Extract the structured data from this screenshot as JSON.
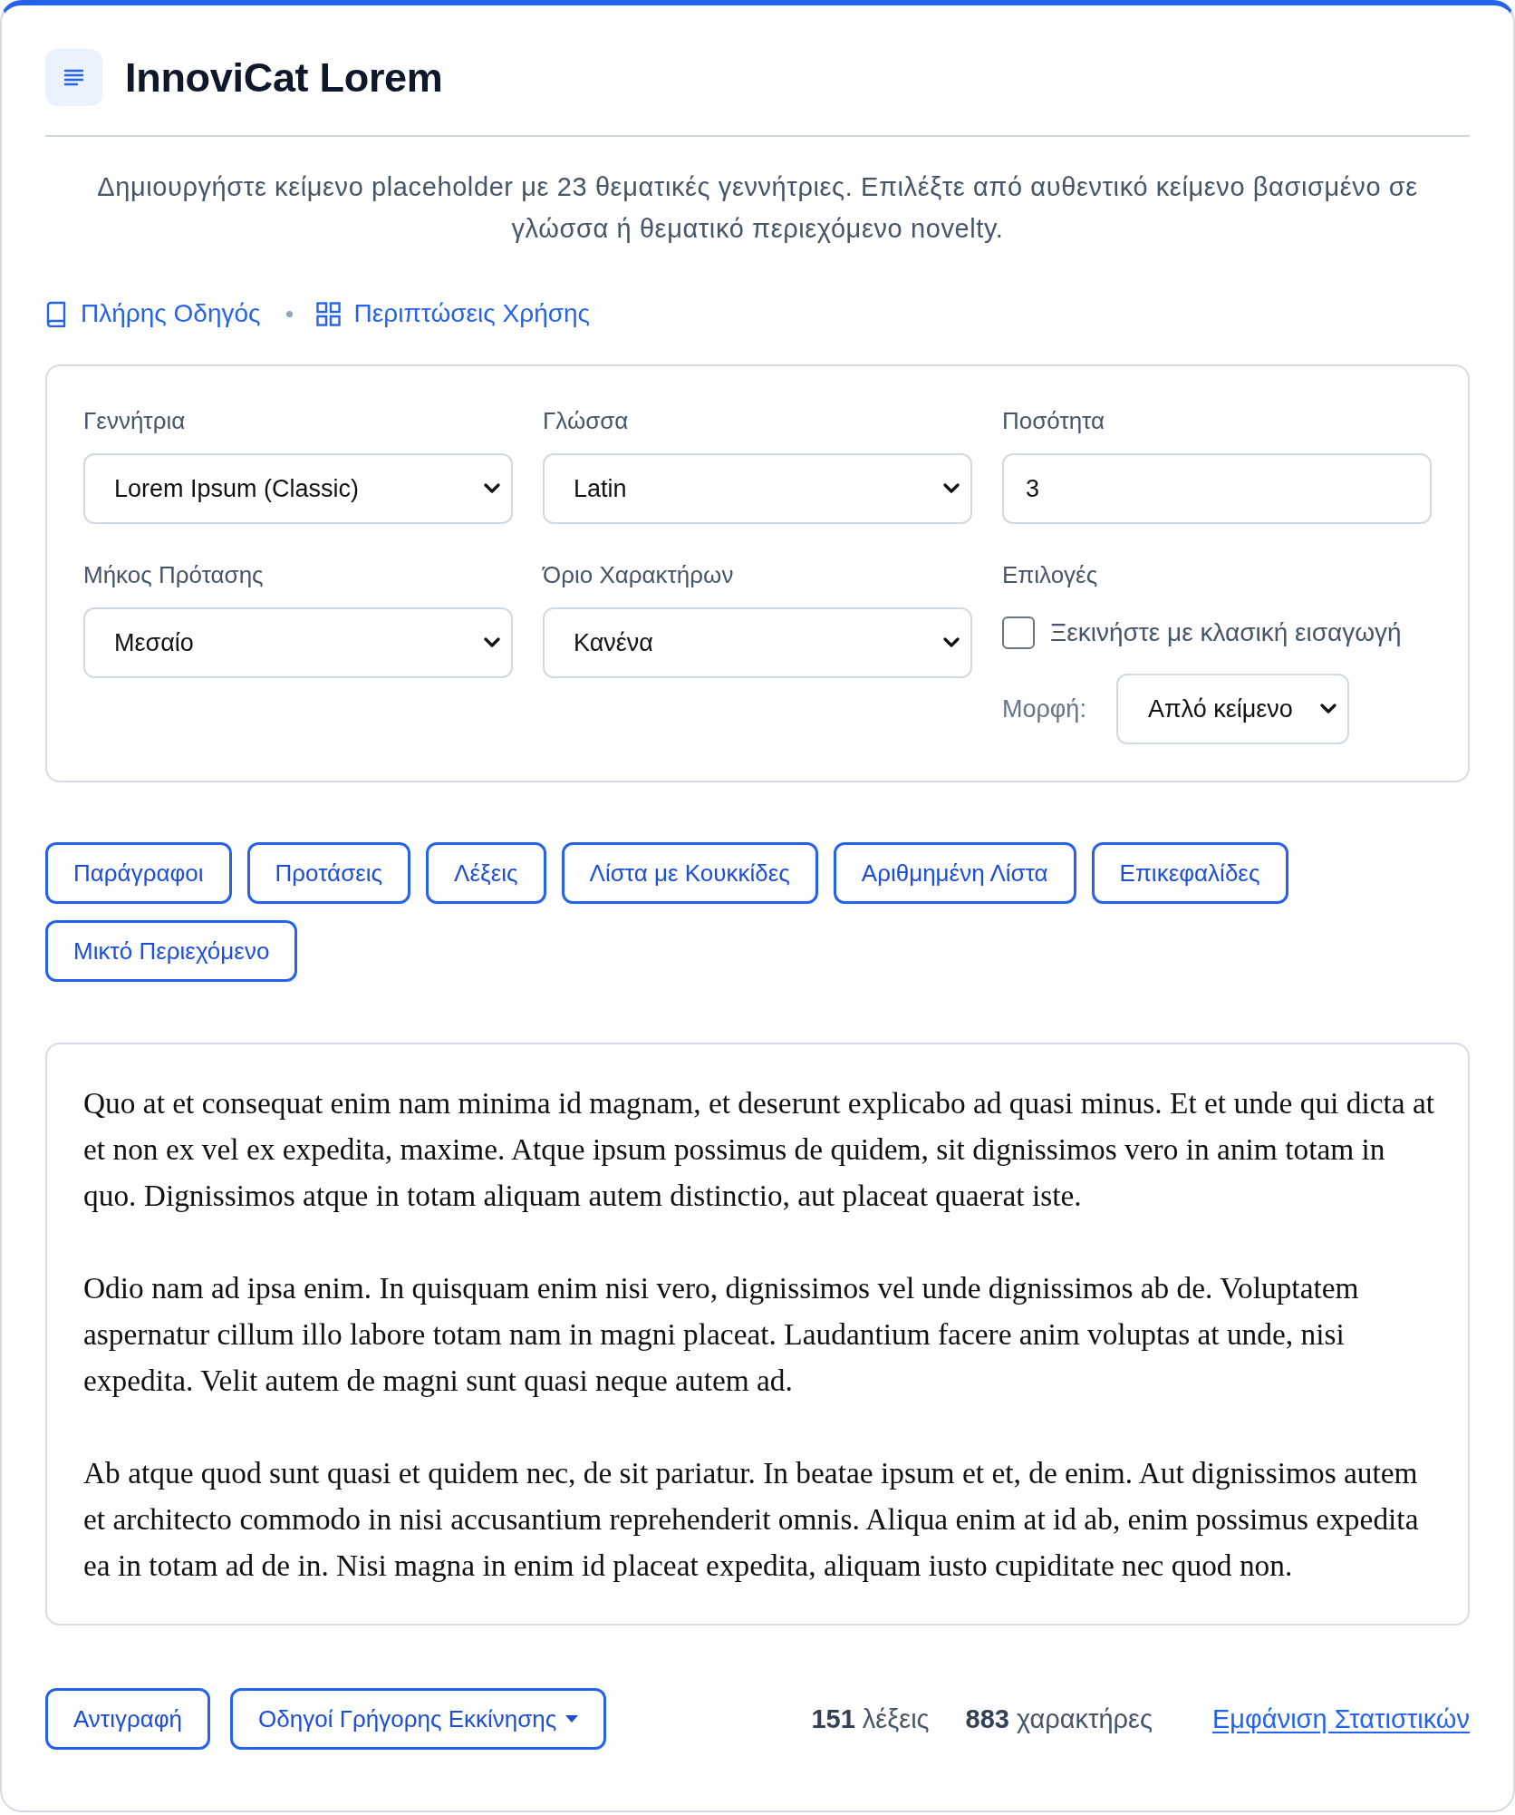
{
  "header": {
    "title": "InnoviCat Lorem"
  },
  "description": "Δημιουργήστε κείμενο placeholder με 23 θεματικές γεννήτριες. Επιλέξτε από αυθεντικό κείμενο βασισμένο σε γλώσσα ή θεματικό περιεχόμενο novelty.",
  "links": [
    "Πλήρης Οδηγός",
    "Περιπτώσεις Χρήσης"
  ],
  "settings": {
    "fields": [
      {
        "kind": "select",
        "label": "Γεννήτρια",
        "value": "Lorem Ipsum (Classic)"
      },
      {
        "kind": "select",
        "label": "Γλώσσα",
        "value": "Latin"
      },
      {
        "kind": "input",
        "label": "Ποσότητα",
        "value": "3"
      },
      {
        "kind": "select",
        "label": "Μήκος Πρότασης",
        "value": "Μεσαίο"
      },
      {
        "kind": "select",
        "label": "Όριο Χαρακτήρων",
        "value": "Κανένα"
      },
      {
        "kind": "options",
        "label": "Επιλογές",
        "checkbox": {
          "label": "Ξεκινήστε με κλασική εισαγωγή",
          "checked": false
        },
        "format": {
          "label": "Μορφή:",
          "value": "Απλό κείμενο"
        }
      }
    ]
  },
  "modes": [
    "Παράγραφοι",
    "Προτάσεις",
    "Λέξεις",
    "Λίστα με Κουκκίδες",
    "Αριθμημένη Λίστα",
    "Επικεφαλίδες",
    "Μικτό Περιεχόμενο"
  ],
  "output": {
    "paragraphs": [
      "Quo at et consequat enim nam minima id magnam, et deserunt explicabo ad quasi minus. Et et unde qui dicta at et non ex vel ex expedita, maxime. Atque ipsum possimus de quidem, sit dignissimos vero in anim totam in quo. Dignissimos atque in totam aliquam autem distinctio, aut placeat quaerat iste.",
      "Odio nam ad ipsa enim. In quisquam enim nisi vero, dignissimos vel unde dignissimos ab de. Voluptatem aspernatur cillum illo labore totam nam in magni placeat. Laudantium facere anim voluptas at unde, nisi expedita. Velit autem de magni sunt quasi neque autem ad.",
      "Ab atque quod sunt quasi et quidem nec, de sit pariatur. In beatae ipsum et et, de enim. Aut dignissimos autem et architecto commodo in nisi accusantium reprehenderit omnis. Aliqua enim at id ab, enim possimus expedita ea in totam ad de in. Nisi magna in enim id placeat expedita, aliquam iusto cupiditate nec quod non."
    ]
  },
  "footer": {
    "buttons": [
      {
        "kind": "plain",
        "label": "Αντιγραφή"
      },
      {
        "kind": "dropdown",
        "label": "Οδηγοί Γρήγορης Εκκίνησης"
      }
    ],
    "stats": [
      "**151** λέξεις",
      "**883** χαρακτήρες"
    ],
    "link": "Εμφάνιση Στατιστικών"
  }
}
